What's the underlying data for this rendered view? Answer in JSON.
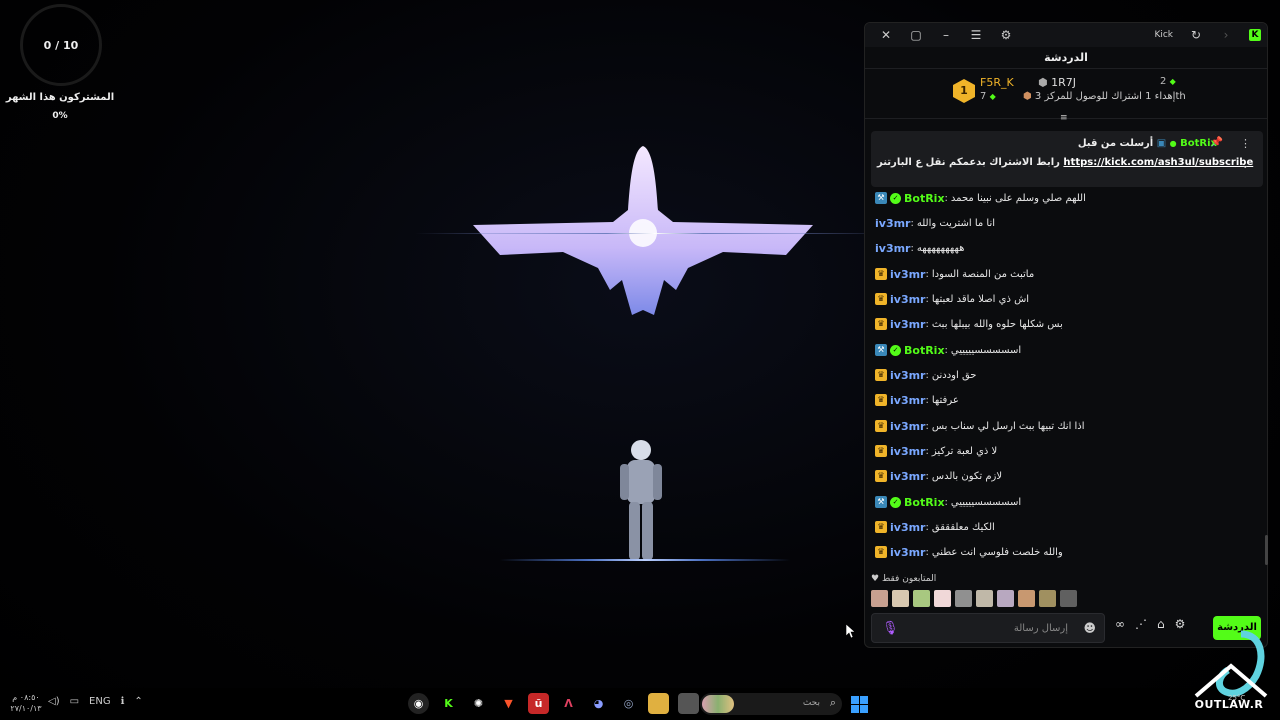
{
  "overlay": {
    "sub_goal": "0 / 10",
    "sub_title": "المشتركون هذا الشهر",
    "sub_pct": "0%"
  },
  "chat_window": {
    "kick_label": "Kick",
    "heading": "الدردشة",
    "leaderboard": {
      "rank": "1",
      "first_name": "F5R_K",
      "first_count": "7",
      "second_name": "1R7J",
      "second_count": "2",
      "gift_prefix": "3",
      "gift_text": "إهداء 1 اشتراك للوصول للمركز",
      "gift_suffix": "th"
    },
    "pinned": {
      "header": "أرسلت من قبل",
      "bot": "BotRix",
      "text": "رابط الاشتراك بدعمكم نقل ع البارتنر",
      "link": "https://kick.com/ash3ul/subscribe"
    },
    "messages": [
      {
        "badge": "bot",
        "verified": true,
        "user": "BotRix",
        "text": "اللهم صلي وسلم على نبينا محمد"
      },
      {
        "badge": "none",
        "verified": false,
        "user": "iv3mr",
        "text": "انا ما اشتريت والله"
      },
      {
        "badge": "none",
        "verified": false,
        "user": "iv3mr",
        "text": "هههههههههه"
      },
      {
        "badge": "sub",
        "verified": false,
        "user": "iv3mr",
        "text": "ماتبث من المنصة السودا"
      },
      {
        "badge": "sub",
        "verified": false,
        "user": "iv3mr",
        "text": "اش ذي اصلا ماقد لعبتها"
      },
      {
        "badge": "sub",
        "verified": false,
        "user": "iv3mr",
        "text": "بس شكلها حلوه والله بيبلها ببث"
      },
      {
        "badge": "bot",
        "verified": true,
        "user": "BotRix",
        "text": "اسسسسسيييييي"
      },
      {
        "badge": "sub",
        "verified": false,
        "user": "iv3mr",
        "text": "حق اوددنن"
      },
      {
        "badge": "sub",
        "verified": false,
        "user": "iv3mr",
        "text": "عرفتها"
      },
      {
        "badge": "sub",
        "verified": false,
        "user": "iv3mr",
        "text": "اذا انك تبيها ببث ارسل لي سناب بس"
      },
      {
        "badge": "sub",
        "verified": false,
        "user": "iv3mr",
        "text": "لا ذي لعبة تركيز"
      },
      {
        "badge": "sub",
        "verified": false,
        "user": "iv3mr",
        "text": "لازم تكون بالدس"
      },
      {
        "badge": "bot",
        "verified": true,
        "user": "BotRix",
        "text": "اسسسسسيييييي"
      },
      {
        "badge": "sub",
        "verified": false,
        "user": "iv3mr",
        "text": "الكيك معلقققق"
      },
      {
        "badge": "sub",
        "verified": false,
        "user": "iv3mr",
        "text": "والله خلصت فلوسي انت عطني"
      }
    ],
    "followers_only": "المتابعون فقط",
    "input_placeholder": "إرسال رسالة",
    "send_label": "الدردشة"
  },
  "taskbar": {
    "time": "٠٨:٥٠ م",
    "date": "٢٧/١٠/١٣",
    "lang": "ENG",
    "search_label": "بحث"
  },
  "watermark": {
    "text": "OUTLAW.R",
    "temp": "25°C"
  },
  "colors": {
    "kick_green": "#53fc18",
    "viewer_blue": "#7aa8ff",
    "sub_gold": "#f0b429"
  }
}
